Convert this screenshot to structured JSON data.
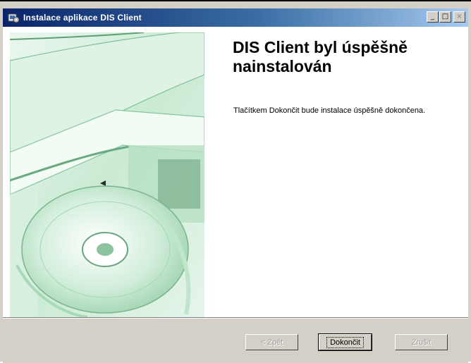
{
  "window": {
    "title": "Instalace aplikace DIS Client",
    "controls": {
      "minimize": "_",
      "maximize": "□",
      "close": "×"
    }
  },
  "main": {
    "heading": "DIS Client byl úspěšně nainstalován",
    "description": "Tlačítkem Dokončit bude instalace úspěšně dokončena."
  },
  "buttons": {
    "back": "< Zpět",
    "finish": "Dokončit",
    "cancel": "Zrušit"
  },
  "colors": {
    "titlebar_start": "#0a246a",
    "titlebar_end": "#a6caf0",
    "art_accent": "#bfe6cc"
  }
}
